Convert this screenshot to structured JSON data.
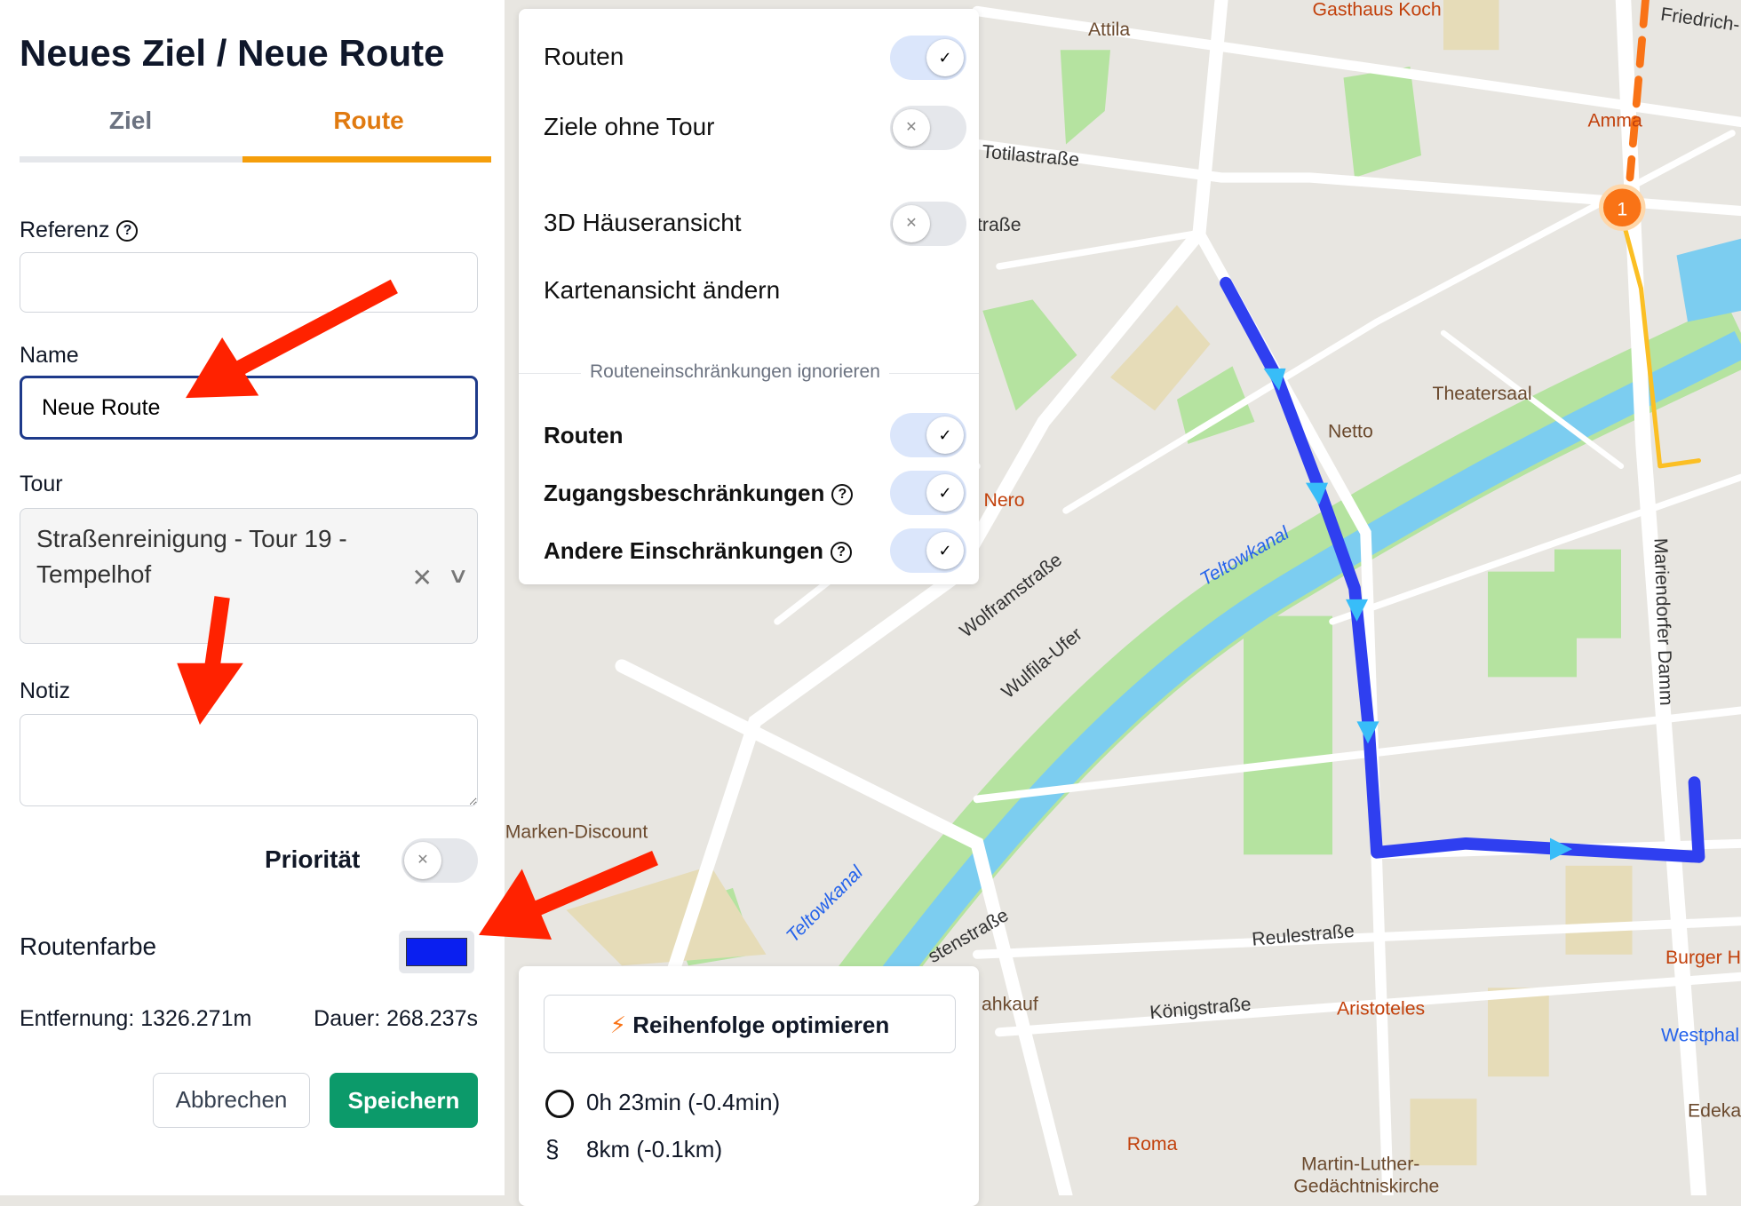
{
  "form": {
    "title": "Neues Ziel / Neue Route",
    "tabs": [
      {
        "label": "Ziel",
        "active": false
      },
      {
        "label": "Route",
        "active": true
      }
    ],
    "referenz_label": "Referenz",
    "referenz_value": "",
    "name_label": "Name",
    "name_value": "Neue Route",
    "tour_label": "Tour",
    "tour_value": "Straßenreinigung - Tour 19 - Tempelhof",
    "notiz_label": "Notiz",
    "notiz_value": "",
    "prioritaet_label": "Priorität",
    "prioritaet_on": false,
    "routenfarbe_label": "Routenfarbe",
    "routenfarbe": "#0a1ff0",
    "entfernung": "Entfernung: 1326.271m",
    "dauer": "Dauer: 268.237s",
    "cancel": "Abbrechen",
    "save": "Speichern"
  },
  "layers": {
    "items": [
      {
        "label": "Routen",
        "on": true
      },
      {
        "label": "Ziele ohne Tour",
        "on": false
      },
      {
        "label": "3D Häuseransicht",
        "on": false
      }
    ],
    "map_view": "Kartenansicht ändern",
    "section": "Routeneinschränkungen ignorieren",
    "restrictions": [
      {
        "label": "Routen",
        "on": true,
        "help": false
      },
      {
        "label": "Zugangsbeschränkungen",
        "on": true,
        "help": true
      },
      {
        "label": "Andere Einschränkungen",
        "on": true,
        "help": true
      }
    ]
  },
  "optimize": {
    "button": "Reihenfolge optimieren",
    "time": "0h 23min (-0.4min)",
    "distance": "8km (-0.1km)"
  },
  "map": {
    "labels": [
      "Attila",
      "Gasthaus Koch",
      "Friedrich-",
      "Amma",
      "Totilastraße",
      "traße",
      "Theatersaal",
      "Netto",
      "Nero",
      "Wolframstraße",
      "Wulfila-Ufer",
      "Teltowkanal",
      "Teltowkanal",
      "Mariendorfer Damm",
      "Marken-Discount",
      "Reulestraße",
      "Königstraße",
      "Aristoteles",
      "Burger H",
      "Westphal",
      "Edeka",
      "Roma",
      "Martin-Luther-",
      "Gedächtniskirche",
      "ahkauf",
      "stenstraße"
    ],
    "stop_number": "1"
  },
  "colors": {
    "accent": "#f59e0b",
    "save": "#0c9a6a",
    "route": "#2f3ff0",
    "annotation": "#ff2200"
  }
}
